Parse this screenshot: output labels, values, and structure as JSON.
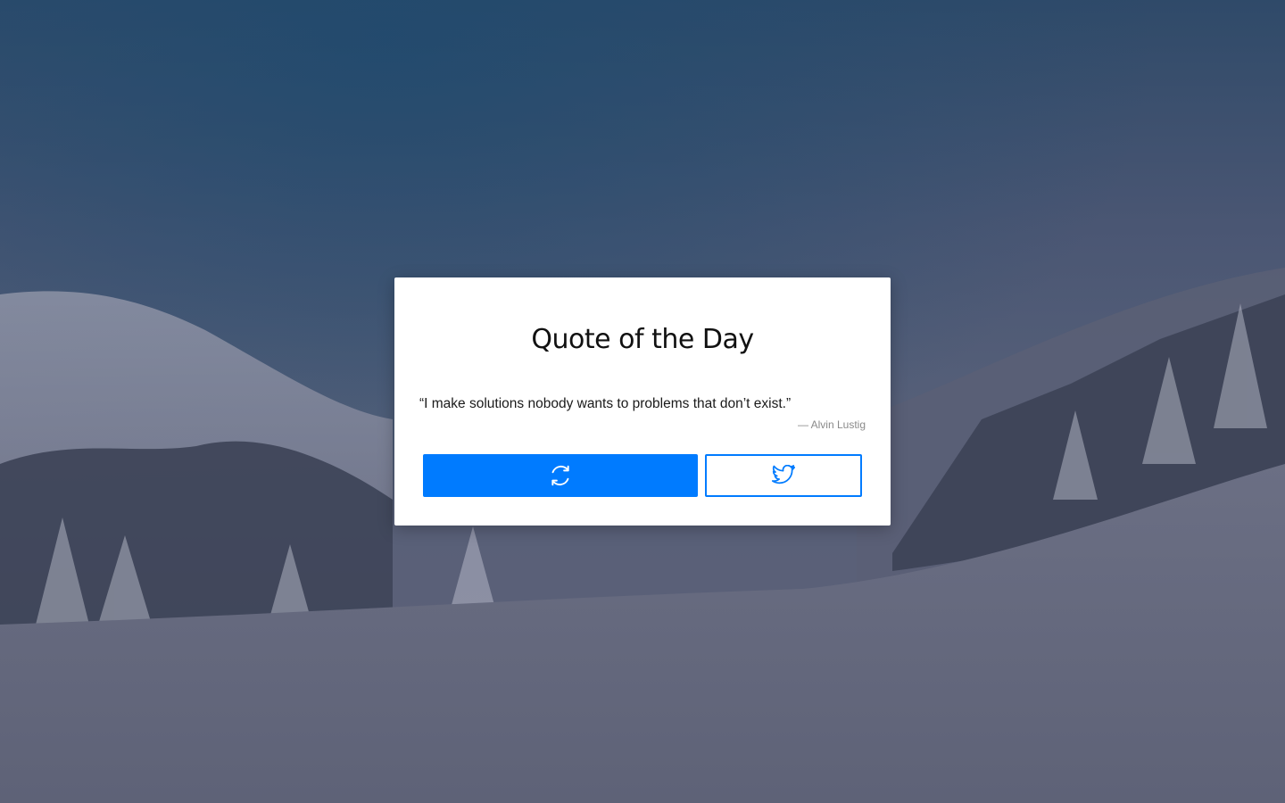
{
  "quote_card": {
    "title": "Quote of the Day",
    "quote_text": "“I make solutions nobody wants to problems that don’t exist.”",
    "author": "— Alvin Lustig"
  },
  "buttons": {
    "new_quote_icon": "refresh-icon",
    "tweet_icon": "twitter-icon"
  },
  "colors": {
    "accent": "#007bff",
    "card_background": "#ffffff",
    "author_text": "#8a8a8a"
  },
  "background": {
    "scene": "snowy-forest-mountain"
  }
}
